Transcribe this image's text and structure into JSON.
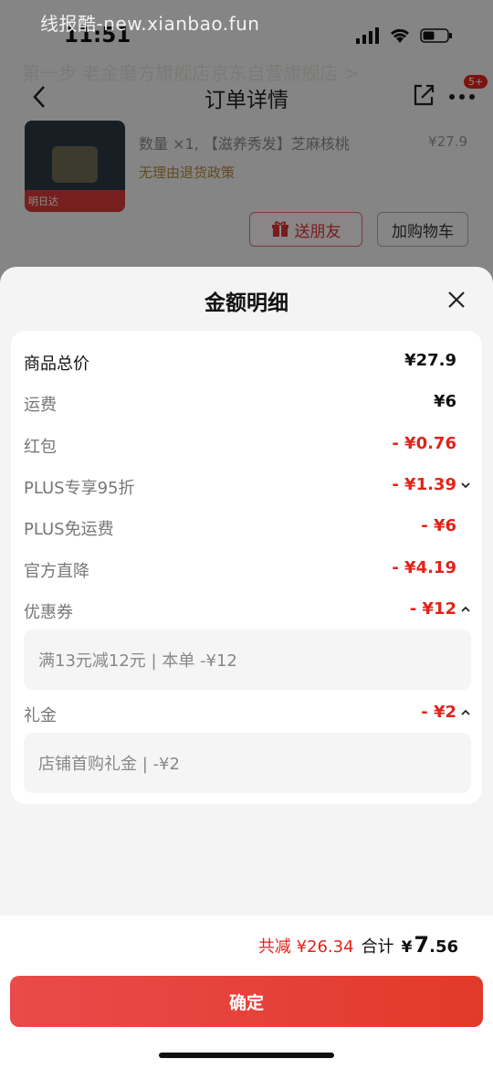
{
  "watermark": "线报酷-new.xianbao.fun",
  "status_bar": {
    "time": "11:51"
  },
  "background": {
    "shop_name": "第一步 老金磨方旗舰店京东自营旗舰店 >",
    "nav": {
      "title": "订单详情",
      "badge": "5+"
    },
    "product": {
      "qty_spec": "数量 ×1, 【滋养秀发】芝麻核桃",
      "price": "¥27.9",
      "policy": "无理由退货政策",
      "thumb_tag": "明日达"
    },
    "buttons": {
      "gift": "送朋友",
      "cart": "加购物车"
    }
  },
  "sheet": {
    "title": "金额明细",
    "rows": [
      {
        "label": "商品总价",
        "value": "¥27.9"
      },
      {
        "label": "运费",
        "value": "¥6"
      },
      {
        "label": "红包",
        "value": "- ¥0.76"
      },
      {
        "label": "PLUS专享95折",
        "value": "- ¥1.39"
      },
      {
        "label": "PLUS免运费",
        "value": "- ¥6"
      },
      {
        "label": "官方直降",
        "value": "- ¥4.19"
      },
      {
        "label": "优惠券",
        "value": "- ¥12"
      },
      {
        "label": "礼金",
        "value": "- ¥2"
      }
    ],
    "coupon_detail": "满13元减12元 | 本单 -¥12",
    "gift_detail": "店铺首购礼金 | -¥2"
  },
  "footer": {
    "saved": "共减 ¥26.34",
    "total_label": "合计",
    "total_symbol": "¥",
    "total_int": "7",
    "total_dec": ".56",
    "confirm": "确定"
  },
  "colors": {
    "accent": "#e2231a",
    "button": "#e63e36"
  }
}
